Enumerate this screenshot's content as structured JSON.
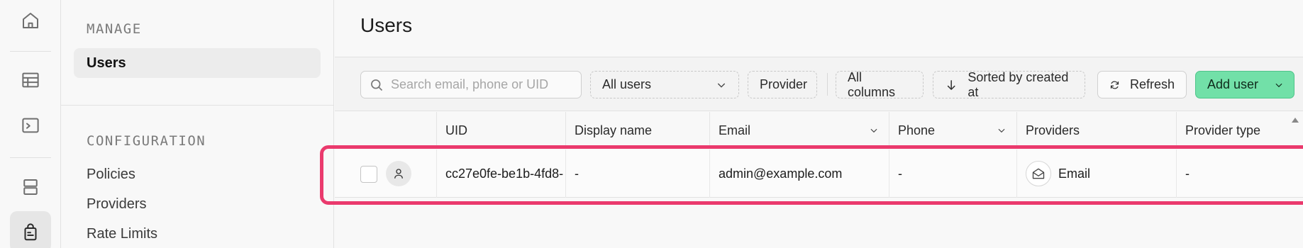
{
  "rail": {
    "icons": [
      "home-icon",
      "table-editor-icon",
      "sql-editor-icon",
      "database-icon",
      "auth-icon"
    ]
  },
  "sidebar": {
    "manage_title": "MANAGE",
    "manage_items": [
      {
        "label": "Users",
        "active": true
      }
    ],
    "config_title": "CONFIGURATION",
    "config_items": [
      {
        "label": "Policies"
      },
      {
        "label": "Providers"
      },
      {
        "label": "Rate Limits"
      }
    ]
  },
  "page": {
    "title": "Users"
  },
  "toolbar": {
    "search_placeholder": "Search email, phone or UID",
    "filter_label": "All users",
    "provider_label": "Provider",
    "columns_label": "All columns",
    "sort_label": "Sorted by created at",
    "refresh_label": "Refresh",
    "add_user_label": "Add user"
  },
  "table": {
    "columns": [
      "UID",
      "Display name",
      "Email",
      "Phone",
      "Providers",
      "Provider type"
    ],
    "rows": [
      {
        "uid": "cc27e0fe-be1b-4fd8-",
        "display_name": "-",
        "email": "admin@example.com",
        "phone": "-",
        "provider": "Email",
        "provider_icon": "mail-icon",
        "provider_type": "-"
      }
    ]
  },
  "colors": {
    "accent_green": "#72e0a8",
    "highlight_pink": "#ea3a6d"
  }
}
